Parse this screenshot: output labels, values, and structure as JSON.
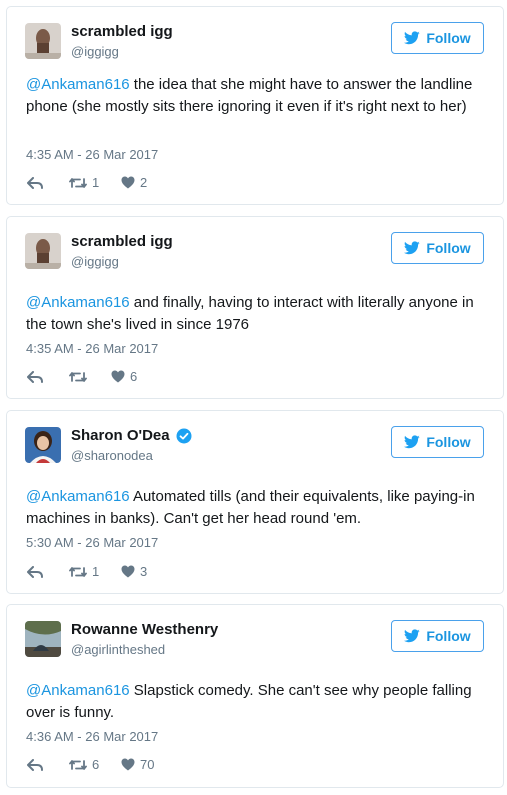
{
  "tweets": [
    {
      "name": "scrambled igg",
      "handle": "@iggigg",
      "verified": false,
      "follow_label": "Follow",
      "mention": "@Ankaman616",
      "text": " the idea that she might have to answer the landline phone (she mostly sits there ignoring it even if it's right next to her)",
      "time": "4:35 AM - 26 Mar 2017",
      "retweets": "1",
      "likes": "2"
    },
    {
      "name": "scrambled igg",
      "handle": "@iggigg",
      "verified": false,
      "follow_label": "Follow",
      "mention": "@Ankaman616",
      "text": " and finally, having to interact with literally anyone in the town she's lived in since 1976",
      "time": "4:35 AM - 26 Mar 2017",
      "retweets": "",
      "likes": "6"
    },
    {
      "name": "Sharon O'Dea",
      "handle": "@sharonodea",
      "verified": true,
      "follow_label": "Follow",
      "mention": "@Ankaman616",
      "text": " Automated tills (and their equivalents, like paying-in machines in banks). Can't get her head round 'em.",
      "time": "5:30 AM - 26 Mar 2017",
      "retweets": "1",
      "likes": "3"
    },
    {
      "name": "Rowanne Westhenry",
      "handle": "@agirlintheshed",
      "verified": false,
      "follow_label": "Follow",
      "mention": "@Ankaman616",
      "text": " Slapstick comedy. She can't see why people falling over is funny.",
      "time": "4:36 AM - 26 Mar 2017",
      "retweets": "6",
      "likes": "70"
    }
  ],
  "colors": {
    "link": "#1b95e0",
    "muted": "#657786",
    "border": "#e1e8ed",
    "verified": "#1da1f2"
  },
  "icons": [
    "reply-icon",
    "retweet-icon",
    "like-icon",
    "twitter-bird-icon",
    "verified-badge-icon"
  ]
}
